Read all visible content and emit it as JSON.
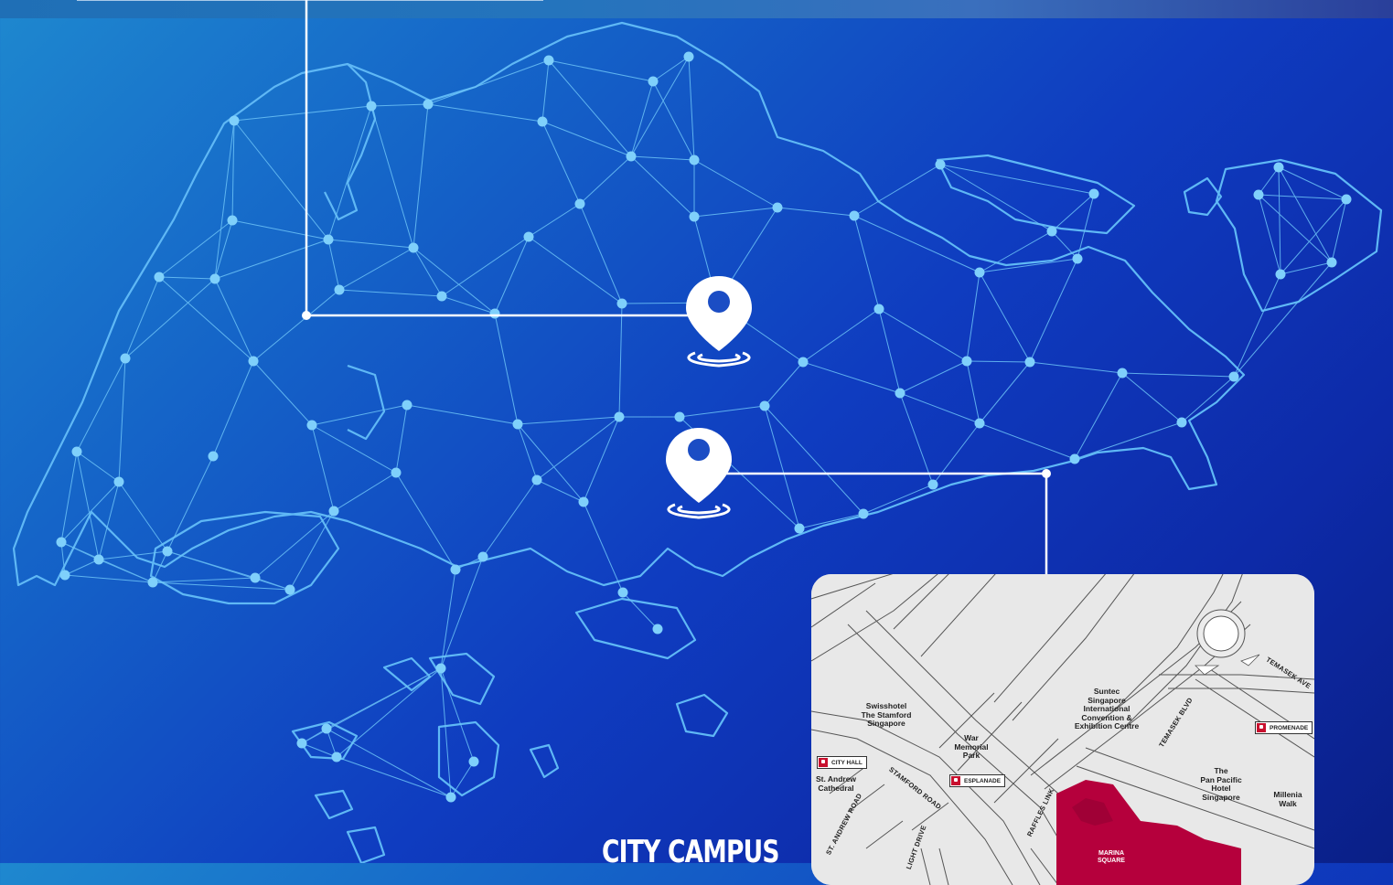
{
  "map": {
    "pins": [
      {
        "name": "north-pin"
      },
      {
        "name": "city-pin"
      }
    ]
  },
  "inset": {
    "labels": {
      "swisshotel": "Swisshotel\nThe Stamford\nSingapore",
      "war_memorial": "War\nMemorial\nPark",
      "suntec": "Suntec\nSingapore\nInternational\nConvention &\nExhibition Centre",
      "pan_pacific": "The\nPan Pacific\nHotel\nSingapore",
      "millenia": "Millenia\nWalk",
      "st_andrew": "St. Andrew\nCathedral",
      "marina_square": "MARINA\nSQUARE"
    },
    "roads": {
      "stamford": "STAMFORD ROAD",
      "st_andrew_road": "ST. ANDREW ROAD",
      "raffles_link": "RAFFLES LINK",
      "temasek_blvd": "TEMASEK BLVD",
      "temasek_ave": "TEMASEK AVE",
      "light_drive": "LIGHT DRIVE"
    },
    "mrt": {
      "city_hall": "CITY HALL",
      "esplanade": "ESPLANADE",
      "promenade": "PROMENADE"
    },
    "colors": {
      "highlight": "#b5003c",
      "road": "#ffffff",
      "block": "#e8e8e8"
    }
  },
  "caption": {
    "city_campus": "CITY CAMPUS"
  }
}
